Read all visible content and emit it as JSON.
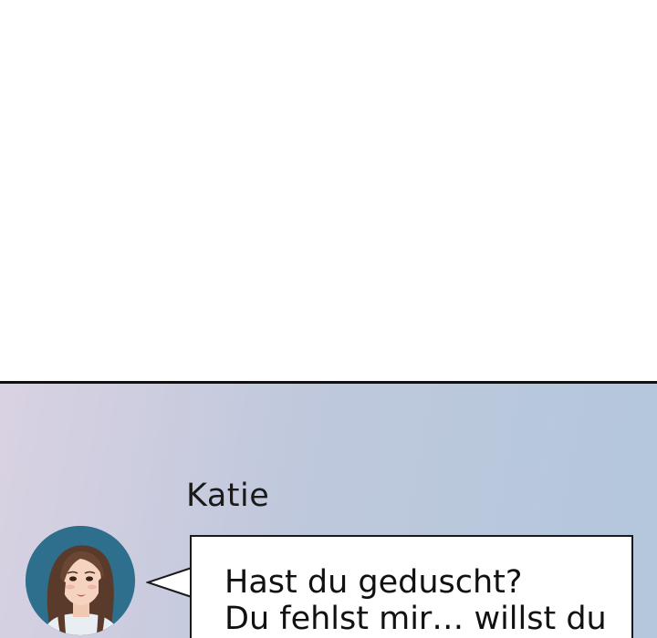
{
  "chat": {
    "sender": "Katie",
    "message": "Hast du geduscht?\nDu fehlst mir… willst du",
    "avatar_icon": "profile-avatar-woman",
    "panel_gradient": [
      "#d9d2e2",
      "#b3c7dd"
    ],
    "avatar_background": "#2d6f8c"
  }
}
